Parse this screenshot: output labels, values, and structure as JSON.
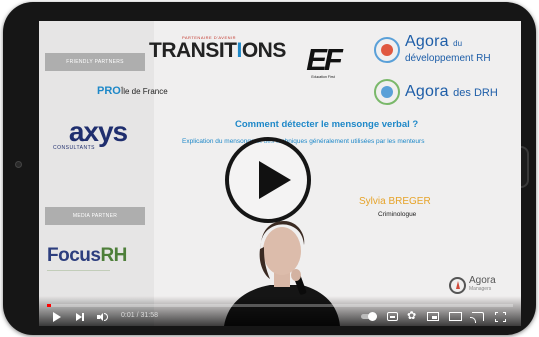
{
  "video": {
    "current_time": "0:01",
    "duration": "31:58",
    "time_label": "0:01 / 31:58",
    "progress_fraction": 0.0005
  },
  "left_panel": {
    "friendly_partners_label": "FRIENDLY PARTNERS",
    "media_partner_label": "MEDIA PARTNER",
    "axys_logo": "axys",
    "axys_sub": "CONSULTANTS",
    "focus_logo_a": "Focus",
    "focus_logo_b": "RH"
  },
  "logos": {
    "transitions_eyebrow": "PARTENAIRE D'AVENIR",
    "transitions_a": "TRANSIT",
    "transitions_i": "I",
    "transitions_b": "ONS",
    "transitions_pro": "PRO",
    "transitions_region": "Île de France",
    "ef": "EF",
    "ef_sub": "Education First",
    "agora_dev_a": "Agora",
    "agora_dev_b": "du",
    "agora_dev_c": "développement RH",
    "agora_drh_a": "Agora",
    "agora_drh_b": "des DRH"
  },
  "talk": {
    "title": "Comment détecter le mensonge verbal ?",
    "subtitle": "Explication du mensonge et des techniques généralement utilisées par les menteurs",
    "speaker_name": "Sylvia BREGER",
    "speaker_role": "Criminologue"
  },
  "watermark": {
    "text": "Agora",
    "sub": "Managers"
  },
  "colors": {
    "accent_blue": "#1e88c8",
    "speaker_name": "#e6a329",
    "progress": "#ff0000"
  },
  "icons": [
    "play-icon",
    "next-icon",
    "volume-icon",
    "autoplay-toggle-icon",
    "subtitles-icon",
    "settings-gear-icon",
    "miniplayer-icon",
    "theater-mode-icon",
    "cast-icon",
    "fullscreen-icon"
  ]
}
